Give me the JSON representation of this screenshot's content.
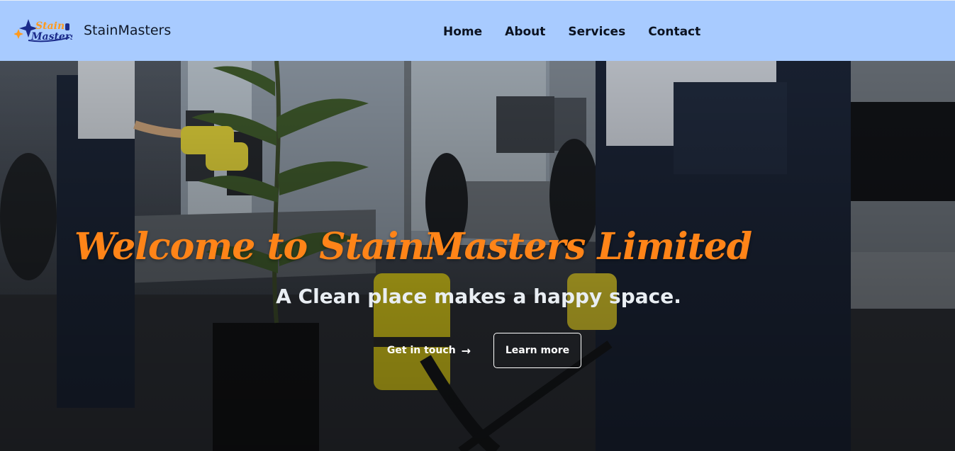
{
  "header": {
    "logo_top_text": "Stain",
    "logo_bottom_text": "Masters",
    "brand_name": "StainMasters",
    "nav": [
      "Home",
      "About",
      "Services",
      "Contact"
    ]
  },
  "hero": {
    "title": "Welcome to StainMasters Limited",
    "subtitle": "A Clean place makes a happy space.",
    "primary_button": "Get in touch",
    "primary_button_icon": "arrow-right-icon",
    "secondary_button": "Learn more"
  },
  "colors": {
    "navbar_bg": "#a8cbff",
    "title_orange": "#ff8418",
    "logo_blue": "#1b2b8a",
    "logo_orange": "#ff9a1e"
  }
}
